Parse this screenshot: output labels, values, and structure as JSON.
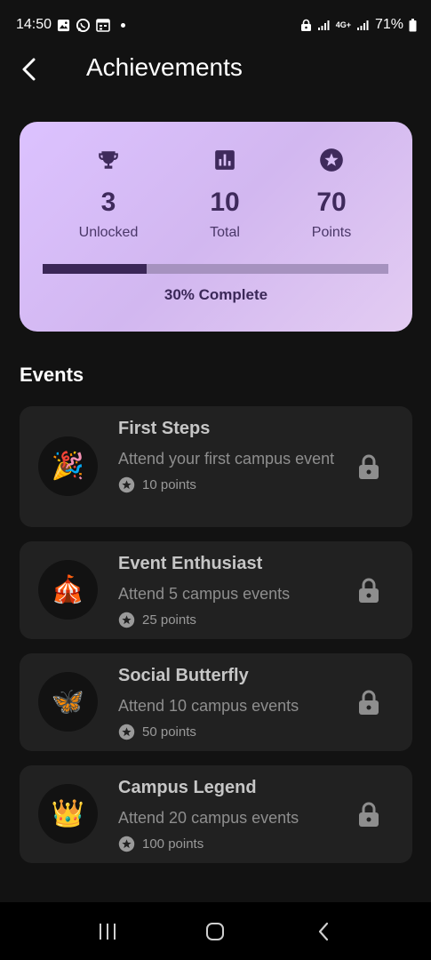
{
  "status_bar": {
    "time": "14:50",
    "network": "4G+",
    "battery": "71%"
  },
  "app_bar": {
    "title": "Achievements"
  },
  "summary": {
    "stats": [
      {
        "icon": "trophy-icon",
        "value": "3",
        "label": "Unlocked"
      },
      {
        "icon": "bar-chart-icon",
        "value": "10",
        "label": "Total"
      },
      {
        "icon": "star-circle-icon",
        "value": "70",
        "label": "Points"
      }
    ],
    "progress_fraction": 0.3,
    "progress_text": "30% Complete"
  },
  "section": {
    "title": "Events"
  },
  "achievements": [
    {
      "emoji": "🎉",
      "title": "First Steps",
      "description": "Attend your first campus event",
      "points": "10 points",
      "locked": true
    },
    {
      "emoji": "🎪",
      "title": "Event Enthusiast",
      "description": "Attend 5 campus events",
      "points": "25 points",
      "locked": true
    },
    {
      "emoji": "🦋",
      "title": "Social Butterfly",
      "description": "Attend 10 campus events",
      "points": "50 points",
      "locked": true
    },
    {
      "emoji": "👑",
      "title": "Campus Legend",
      "description": "Attend 20 campus events",
      "points": "100 points",
      "locked": true
    }
  ],
  "colors": {
    "background": "#121212",
    "card": "#212121",
    "summary_gradient_start": "#dcc2ff",
    "summary_text": "#3b2858",
    "progress_fill": "#3b2657",
    "progress_track": "#a692bf"
  }
}
